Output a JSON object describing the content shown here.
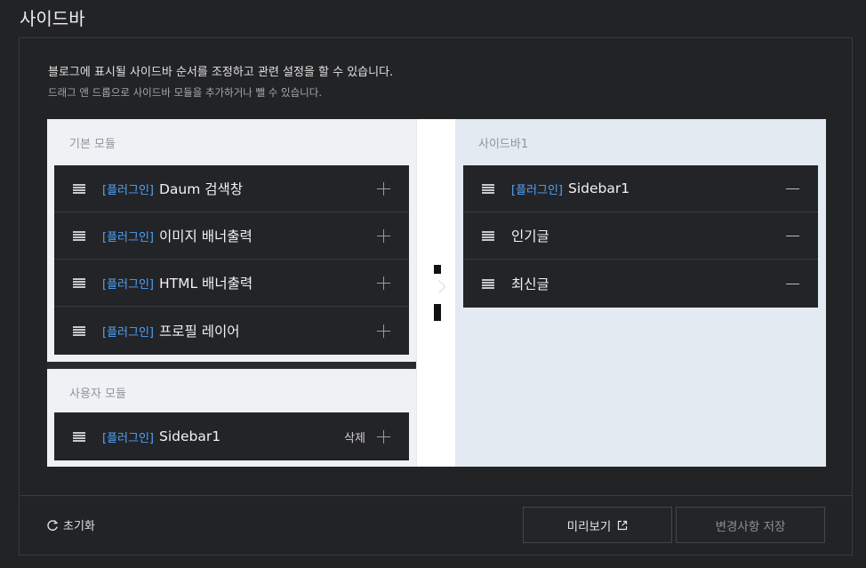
{
  "page": {
    "title": "사이드바"
  },
  "description": {
    "main": "블로그에 표시될 사이드바 순서를 조정하고 관련 설정을 할 수 있습니다.",
    "sub": "드래그 앤 드롭으로 사이드바 모듈을 추가하거나 뺄 수 있습니다."
  },
  "basic_modules": {
    "label": "기본 모듈",
    "items": [
      {
        "tag": "[플러그인]",
        "name": "Daum 검색창"
      },
      {
        "tag": "[플러그인]",
        "name": "이미지 배너출력"
      },
      {
        "tag": "[플러그인]",
        "name": "HTML 배너출력"
      },
      {
        "tag": "[플러그인]",
        "name": "프로필 레이어"
      }
    ]
  },
  "user_modules": {
    "label": "사용자 모듈",
    "items": [
      {
        "tag": "[플러그인]",
        "name": "Sidebar1",
        "delete_label": "삭제"
      }
    ]
  },
  "sidebar1": {
    "label": "사이드바1",
    "items": [
      {
        "tag": "[플러그인]",
        "name": "Sidebar1"
      },
      {
        "tag": "",
        "name": "인기글"
      },
      {
        "tag": "",
        "name": "최신글"
      }
    ]
  },
  "footer": {
    "reset_label": "초기화",
    "preview_label": "미리보기",
    "save_label": "변경사항 저장"
  },
  "colors": {
    "accent_tag": "#4ea3ff",
    "background": "#222325"
  }
}
